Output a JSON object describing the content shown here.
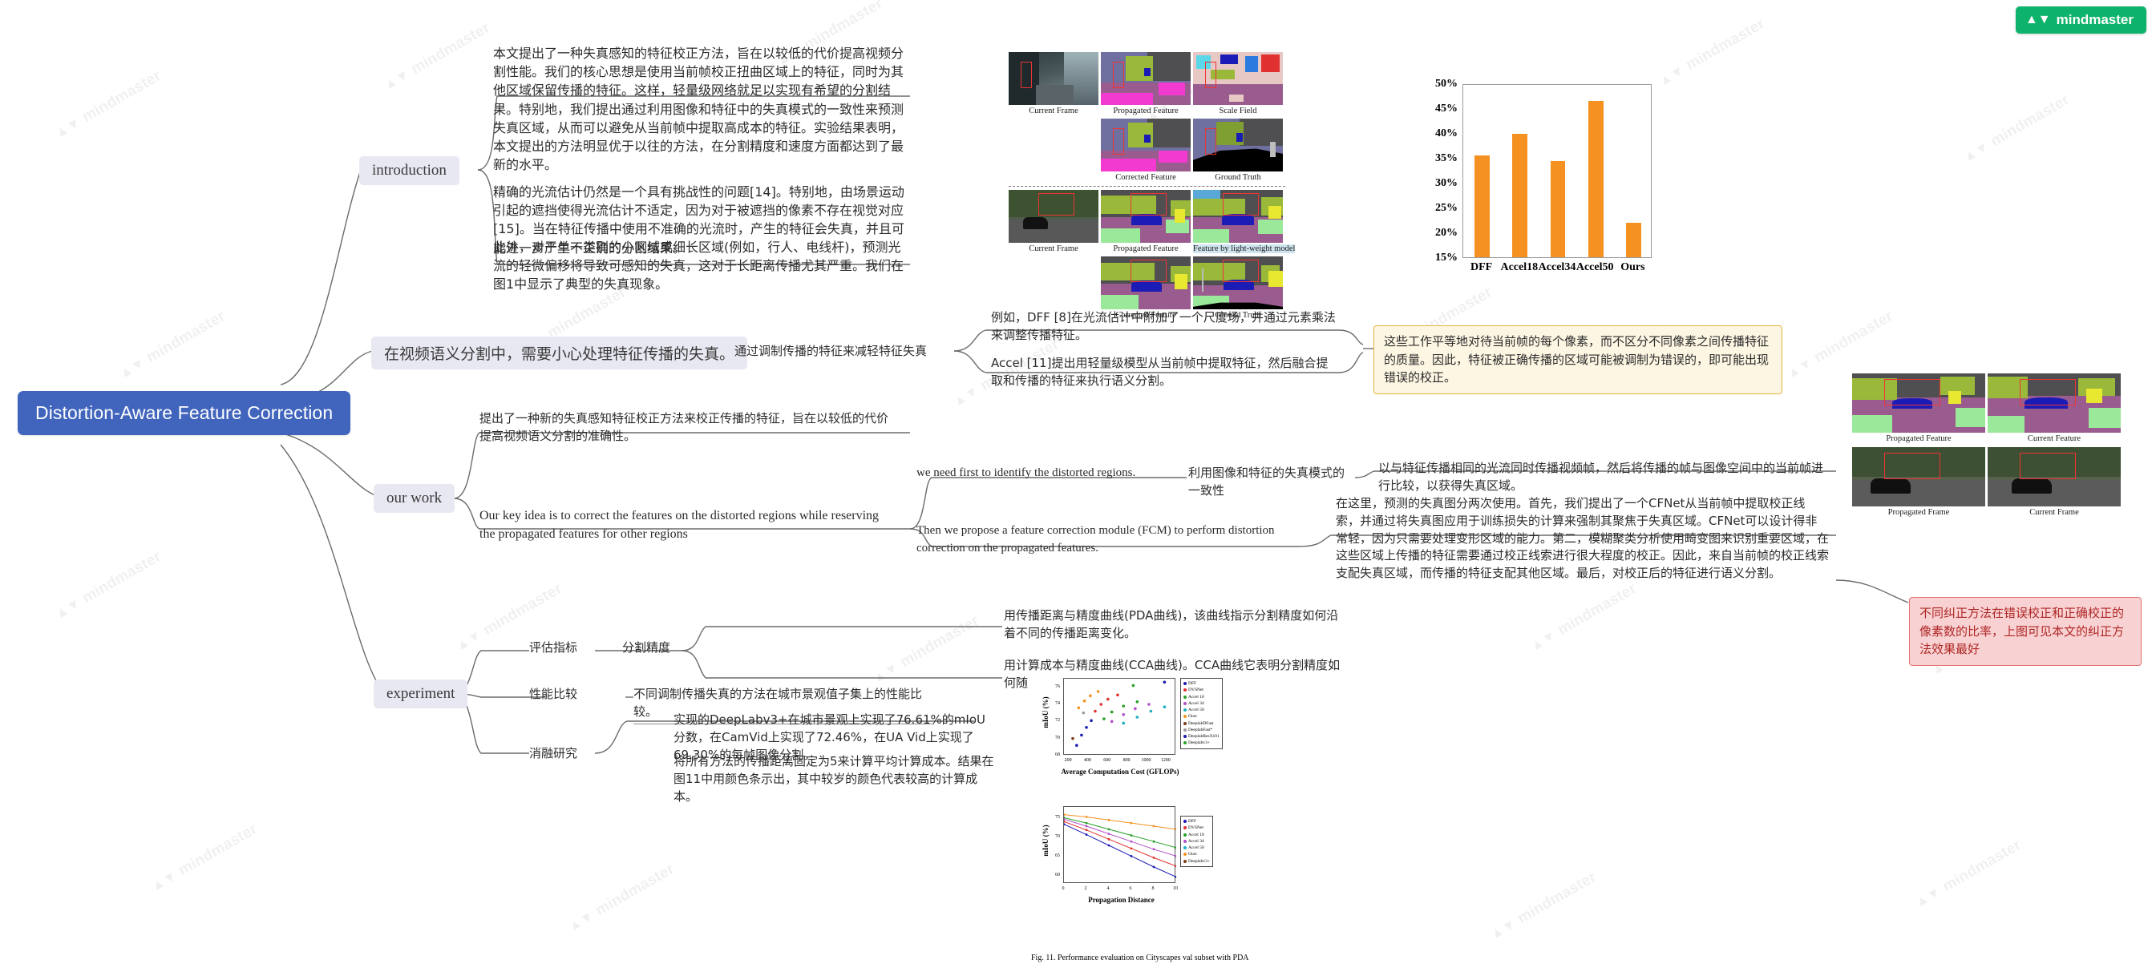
{
  "brand": {
    "name": "mindmaster",
    "logo_icon": "mindmaster-logo-icon",
    "color": "#0db36b"
  },
  "watermark": {
    "text": "mindmaster",
    "logo_icon": "mindmaster-watermark-icon"
  },
  "root": {
    "label": "Distortion-Aware Feature Correction",
    "color": "#4165bd"
  },
  "branches": {
    "introduction": {
      "label": "introduction",
      "abstract": "本文提出了一种失真感知的特征校正方法，旨在以较低的代价提高视频分割性能。我们的核心思想是使用当前帧校正扭曲区域上的特征，同时为其他区域保留传播的特征。这样，轻量级网络就足以实现有希望的分割结果。特别地，我们提出通过利用图像和特征中的失真模式的一致性来预测失真区域，从而可以避免从当前帧中提取高成本的特征。实验结果表明，本文提出的方法明显优于以往的方法，在分割精度和速度方面都达到了最新的水平。",
      "para1": "精确的光流估计仍然是一个具有挑战性的问题[14]。特别地，由场景运动引起的遮挡使得光流估计不适定，因为对于被遮挡的像素不存在视觉对应[15]。当在特征传播中使用不准确的光流时，产生的特征会失真，并且可能进一步产生不正确的分割结果。",
      "para2": "此外，对于单一类别的小区域或细长区域(例如，行人、电线杆)，预测光流的轻微偏移将导致可感知的失真，这对于长距离传播尤其严重。我们在图1中显示了典型的失真现象。"
    },
    "distortion": {
      "statement": "在视频语义分割中，需要小心处理特征传播的失真。",
      "sub_label": "通过调制传播的特征来减轻特征失真",
      "item1": "例如，DFF [8]在光流估计中附加了一个尺度场，并通过元素乘法来调整传播特征。",
      "item2": "Accel [11]提出用轻量级模型从当前帧中提取特征，然后融合提取和传播的特征来执行语义分割。",
      "callout": "这些工作平等地对待当前帧的每个像素，而不区分不同像素之间传播特征的质量。因此，特征被正确传播的区域可能被调制为错误的，即可能出现错误的校正。"
    },
    "our_work": {
      "label": "our work",
      "intro": "提出了一种新的失真感知特征校正方法来校正传播的特征，旨在以较低的代价提高视频语义分割的准确性。",
      "key_idea": "Our key idea is to correct the features on the distorted regions while reserving the propagated features for other regions",
      "need_first": "we need first to identify the distorted regions.",
      "consistency": "利用图像和特征的失真模式的一致性",
      "propagate": "以与特征传播相同的光流同时传播视频帧，然后将传播的帧与图像空间中的当前帧进行比较，以获得失真区域。",
      "fcm": "Then we propose a feature correction module (FCM) to perform distortion correction on the propagated features.",
      "detail": "在这里，预测的失真图分两次使用。首先，我们提出了一个CFNet从当前帧中提取校正线索，并通过将失真图应用于训练损失的计算来强制其聚焦于失真区域。CFNet可以设计得非常轻，因为只需要处理变形区域的能力。第二，模糊聚类分析使用畸变图来识别重要区域，在这些区域上传播的特征需要通过校正线索进行很大程度的校正。因此，来自当前帧的校正线索支配失真区域，而传播的特征支配其他区域。最后，对校正后的特征进行语义分割。",
      "red_callout": "不同纠正方法在错误校正和正确校正的像素数的比率，上图可见本文的纠正方法效果最好"
    },
    "experiment": {
      "label": "experiment",
      "metric_label": "评估指标",
      "accuracy_label": "分割精度",
      "pda": "用传播距离与精度曲线(PDA曲线)，该曲线指示分割精度如何沿着不同的传播距离变化。",
      "cca": "用计算成本与精度曲线(CCA曲线)。CCA曲线它表明分割精度如何随着不同的平均计算成本而变化。",
      "perf_label": "性能比较",
      "perf_text": "不同调制传播失真的方法在城市景观值子集上的性能比较。",
      "ablation_label": "消融研究",
      "ablation_text1": "实现的DeepLabv3+在城市景观上实现了76.61%的mIoU分数，在CamVid上实现了72.46%，在UA Vid上实现了69.30%的每帧图像分割。",
      "ablation_text2": "将所有方法的传播距离固定为5来计算平均计算成本。结果在图11中用颜色条示出，其中较岁的颜色代表较高的计算成本。"
    }
  },
  "figure_segmentation": {
    "row1": [
      {
        "caption": "Current Frame"
      },
      {
        "caption": "Propagated Feature"
      },
      {
        "caption": "Scale Field"
      }
    ],
    "row2": [
      {
        "caption": "Corrected Feature"
      },
      {
        "caption": "Ground Truth"
      }
    ],
    "row3": [
      {
        "caption": "Current Frame"
      },
      {
        "caption": "Propagated Feature"
      },
      {
        "caption": "Feature by light-weight model",
        "highlight": true
      }
    ],
    "row4": [
      {
        "caption": "Corrected Feature"
      },
      {
        "caption": "Ground Truth"
      }
    ]
  },
  "figure_photos": {
    "top": [
      {
        "caption": "Propagated Feature"
      },
      {
        "caption": "Current Feature"
      }
    ],
    "bottom": [
      {
        "caption": "Propagated Frame"
      },
      {
        "caption": "Current Frame"
      }
    ]
  },
  "chart_data": [
    {
      "type": "bar",
      "title": "",
      "categories": [
        "DFF",
        "Accel18",
        "Accel34",
        "Accel50",
        "Ours"
      ],
      "values": [
        35.5,
        39.9,
        34.3,
        46.4,
        21.9
      ],
      "ylabel": "",
      "xlabel": "",
      "ylim": [
        15,
        50
      ],
      "yticks": [
        "15%",
        "20%",
        "25%",
        "30%",
        "35%",
        "40%",
        "45%",
        "50%"
      ],
      "bar_color": "#f59120",
      "grid": false
    },
    {
      "type": "scatter",
      "title": "",
      "xlabel": "Average Computation Cost (GFLOPs)",
      "ylabel": "mIoU (%)",
      "xlim": [
        150,
        1300
      ],
      "ylim": [
        68,
        77
      ],
      "xticks": [
        "200",
        "400",
        "600",
        "800",
        "1000",
        "1200"
      ],
      "yticks": [
        "68",
        "70",
        "72",
        "74",
        "76"
      ],
      "legend_position": "right",
      "series": [
        {
          "name": "DFF",
          "color": "#1b1bb5",
          "values": [
            [
              280,
              69.2
            ],
            [
              330,
              70.4
            ],
            [
              380,
              71.3
            ],
            [
              430,
              72.1
            ]
          ]
        },
        {
          "name": "DVSNet",
          "color": "#e03030",
          "values": [
            [
              470,
              73.2
            ],
            [
              530,
              74.0
            ],
            [
              600,
              74.6
            ],
            [
              700,
              75.1
            ]
          ]
        },
        {
          "name": "Accel 18",
          "color": "#27a027",
          "values": [
            [
              560,
              72.3
            ],
            [
              640,
              73.1
            ],
            [
              760,
              73.8
            ],
            [
              900,
              74.3
            ]
          ]
        },
        {
          "name": "Accel 34",
          "color": "#b050c8",
          "values": [
            [
              640,
              72.0
            ],
            [
              760,
              72.8
            ],
            [
              880,
              73.5
            ],
            [
              1020,
              74.0
            ]
          ]
        },
        {
          "name": "Accel 50",
          "color": "#20b0c0",
          "values": [
            [
              760,
              71.8
            ],
            [
              900,
              72.5
            ],
            [
              1040,
              73.2
            ],
            [
              1180,
              73.7
            ]
          ]
        },
        {
          "name": "Ours",
          "color": "#f59120",
          "values": [
            [
              300,
              73.6
            ],
            [
              360,
              74.4
            ],
            [
              420,
              75.0
            ],
            [
              500,
              75.5
            ]
          ]
        },
        {
          "name": "DeeplabDFast",
          "color": "#7a3b18",
          "values": [
            [
              240,
              70.0
            ]
          ]
        },
        {
          "name": "DeeplabFast*",
          "color": "#999999",
          "values": [
            [
              350,
              73.0
            ]
          ]
        },
        {
          "name": "DeeplabResX101",
          "color": "#1b1bb5",
          "values": [
            [
              1180,
              76.6
            ]
          ]
        },
        {
          "name": "Deeplabv3+",
          "color": "#27a027",
          "values": [
            [
              860,
              76.2
            ]
          ]
        }
      ]
    },
    {
      "type": "line",
      "title": "",
      "xlabel": "Propagation Distance",
      "ylabel": "mIoU (%)",
      "xticks": [
        "0",
        "2",
        "4",
        "6",
        "8",
        "10"
      ],
      "yticks": [
        "60",
        "65",
        "70",
        "75"
      ],
      "legend_position": "right",
      "legend_entries": [
        "DFF",
        "DVSNet",
        "Accel 18",
        "Accel 34",
        "Accel 50",
        "Ours",
        "Deeplabv3+"
      ],
      "series": [
        {
          "name": "Ours",
          "color": "#f59120",
          "values": [
            76,
            75.4,
            74.6,
            73.8,
            73.0,
            72.2
          ]
        },
        {
          "name": "Accel 18",
          "color": "#27a027",
          "values": [
            75.2,
            73.8,
            72.2,
            70.6,
            69.0,
            67.4
          ]
        },
        {
          "name": "Accel 34",
          "color": "#b050c8",
          "values": [
            74.8,
            73.0,
            71.0,
            69.0,
            67.0,
            65.2
          ]
        },
        {
          "name": "DVSNet",
          "color": "#e03030",
          "values": [
            74.2,
            72.0,
            69.6,
            67.2,
            64.8,
            62.6
          ]
        },
        {
          "name": "DFF",
          "color": "#1b1bb5",
          "values": [
            73.5,
            70.8,
            68.0,
            65.2,
            62.4,
            59.8
          ]
        }
      ]
    }
  ],
  "figure_caption": "Fig. 11.  Performance evaluation on Cityscapes val subset with PDA"
}
